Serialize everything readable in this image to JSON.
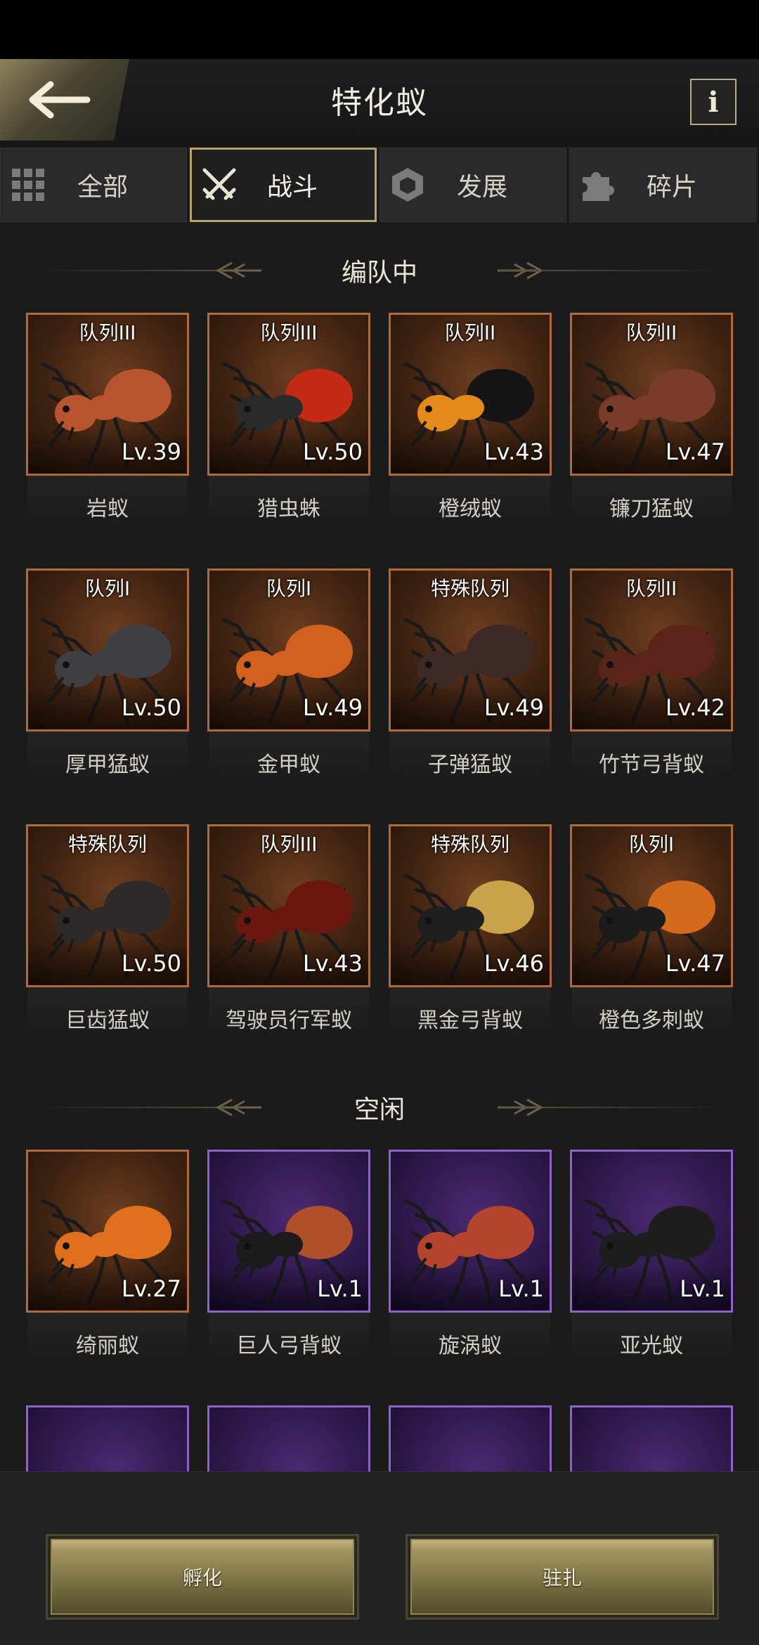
{
  "header": {
    "title": "特化蚁",
    "back_icon": "back-arrow-icon",
    "info_label": "i"
  },
  "tabs": [
    {
      "label": "全部",
      "icon": "grid-icon"
    },
    {
      "label": "战斗",
      "icon": "crossed-swords-icon",
      "active": true
    },
    {
      "label": "发展",
      "icon": "hexagon-icon"
    },
    {
      "label": "碎片",
      "icon": "puzzle-icon"
    }
  ],
  "sections": {
    "formation": "编队中",
    "idle": "空闲"
  },
  "formation_ants": [
    {
      "squad": "队列III",
      "level": "Lv.39",
      "name": "岩蚁",
      "color": "#b8542f"
    },
    {
      "squad": "队列III",
      "level": "Lv.50",
      "name": "猎虫蛛",
      "color": "#2a2a2a",
      "accent": "#c52a17"
    },
    {
      "squad": "队列II",
      "level": "Lv.43",
      "name": "橙绒蚁",
      "color": "#e48a1a",
      "accent": "#151515"
    },
    {
      "squad": "队列II",
      "level": "Lv.47",
      "name": "镰刀猛蚁",
      "color": "#7b3b2a"
    },
    {
      "squad": "队列I",
      "level": "Lv.50",
      "name": "厚甲猛蚁",
      "color": "#3f4045"
    },
    {
      "squad": "队列I",
      "level": "Lv.49",
      "name": "金甲蚁",
      "color": "#d2601e"
    },
    {
      "squad": "特殊队列",
      "level": "Lv.49",
      "name": "子弹猛蚁",
      "color": "#3d2a26"
    },
    {
      "squad": "队列II",
      "level": "Lv.42",
      "name": "竹节弓背蚁",
      "color": "#5a2418"
    },
    {
      "squad": "特殊队列",
      "level": "Lv.50",
      "name": "巨齿猛蚁",
      "color": "#2e2a2a"
    },
    {
      "squad": "队列III",
      "level": "Lv.43",
      "name": "驾驶员行军蚁",
      "color": "#6a1710"
    },
    {
      "squad": "特殊队列",
      "level": "Lv.46",
      "name": "黑金弓背蚁",
      "color": "#1f1f1f",
      "accent": "#c9a24a"
    },
    {
      "squad": "队列I",
      "level": "Lv.47",
      "name": "橙色多刺蚁",
      "color": "#1c1c1c",
      "accent": "#d46a1c"
    }
  ],
  "idle_ants": [
    {
      "level": "Lv.27",
      "name": "绮丽蚁",
      "color": "#e0701e",
      "frame": "orange"
    },
    {
      "level": "Lv.1",
      "name": "巨人弓背蚁",
      "color": "#1b1b1b",
      "accent": "#b0502a",
      "frame": "purple"
    },
    {
      "level": "Lv.1",
      "name": "旋涡蚁",
      "color": "#b4442e",
      "frame": "purple"
    },
    {
      "level": "Lv.1",
      "name": "亚光蚁",
      "color": "#1e1e1e",
      "frame": "purple"
    }
  ],
  "footer": {
    "hatch_label": "孵化",
    "station_label": "驻扎"
  }
}
